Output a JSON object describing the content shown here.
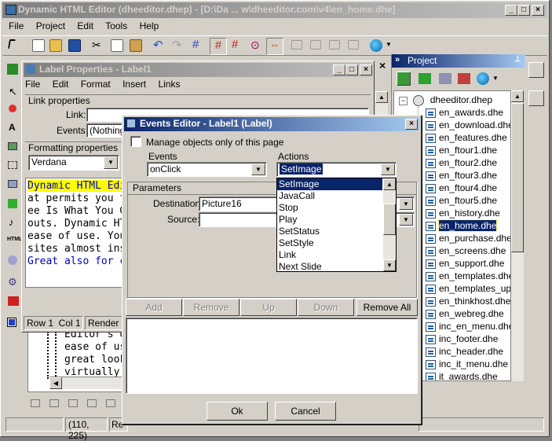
{
  "main_window": {
    "title": "Dynamic HTML Editor (dheeditor.dhep) - [D:\\Da ... w\\dheeditor.com\\v4\\en_home.dhe]",
    "menu": [
      "File",
      "Project",
      "Edit",
      "Tools",
      "Help"
    ]
  },
  "label_properties": {
    "title": "Label Properties - Label1",
    "menu": [
      "File",
      "Edit",
      "Format",
      "Insert",
      "Links"
    ],
    "link_group_title": "Link properties",
    "link_label": "Link:",
    "link_value": "",
    "events_label": "Events:",
    "events_value": "(Nothing",
    "formatting_group_title": "Formatting properties",
    "font_value": "Verdana",
    "preview_lines": [
      "Dynamic HTML Edi",
      "at permits you to",
      "ee Is What You Ge",
      "outs. Dynamic HTI",
      "ease of use. You'l",
      "sites almost instar",
      "Great also for crea"
    ],
    "status_position": "Row 1  Col 1",
    "status_render": "Render T"
  },
  "editor_fragments": [
    "Editor's de",
    "ease of use",
    "great lookin",
    "virtually nc"
  ],
  "status_bar": {
    "coords": "(110, 225)",
    "extra": "Re"
  },
  "project": {
    "title": "Project",
    "root": "dheeditor.dhep",
    "files": [
      "en_awards.dhe",
      "en_download.dhe",
      "en_features.dhe",
      "en_ftour1.dhe",
      "en_ftour2.dhe",
      "en_ftour3.dhe",
      "en_ftour4.dhe",
      "en_ftour5.dhe",
      "en_history.dhe",
      "en_home.dhe",
      "en_purchase.dhe",
      "en_screens.dhe",
      "en_support.dhe",
      "en_templates.dhe",
      "en_templates_up.c",
      "en_thinkhost.dhe",
      "en_webreg.dhe",
      "inc_en_menu.dhe",
      "inc_footer.dhe",
      "inc_header.dhe",
      "inc_it_menu.dhe",
      "it_awards.dhe"
    ],
    "selected": "en_home.dhe"
  },
  "events_editor": {
    "title": "Events Editor - Label1 (Label)",
    "manage_checkbox_label": "Manage objects only of this page",
    "events_label": "Events",
    "events_value": "onClick",
    "actions_label": "Actions",
    "actions_value": "SetImage",
    "actions_options": [
      "SetImage",
      "JavaCall",
      "Stop",
      "Play",
      "SetStatus",
      "SetStyle",
      "Link",
      "Next Slide"
    ],
    "parameters_title": "Parameters",
    "destination_label": "Destination:",
    "destination_value": "Picture16",
    "source_label": "Source:",
    "source_value": "",
    "buttons": {
      "add": "Add",
      "remove": "Remove",
      "up": "Up",
      "down": "Down",
      "remove_all": "Remove All",
      "ok": "Ok",
      "cancel": "Cancel"
    }
  },
  "colors": {
    "active_title": "#0a246a",
    "window_bg": "#d4d0c8",
    "preview_highlight": "#ffff00",
    "preview_blue": "#0000c0"
  }
}
